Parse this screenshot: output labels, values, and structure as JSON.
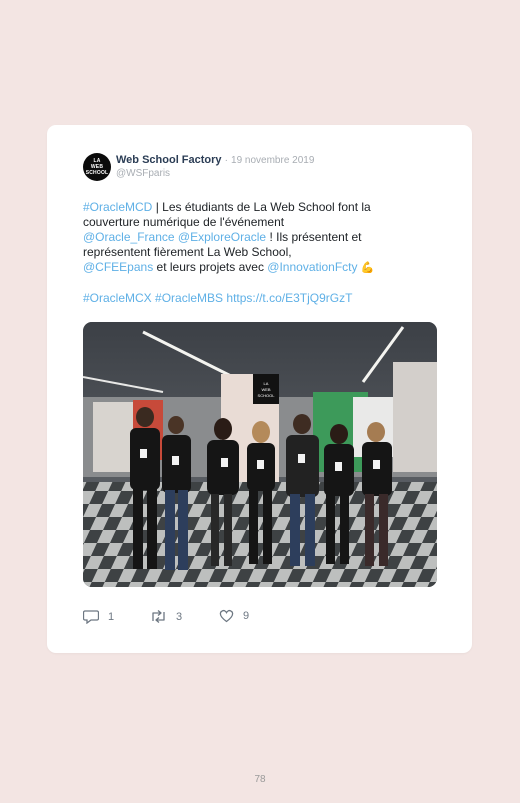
{
  "author": {
    "name": "Web School Factory",
    "separator": "·",
    "date": "19 novembre 2019",
    "handle": "@WSFparis",
    "avatar_lines": [
      "LA",
      "WEB",
      "SCHOOL"
    ]
  },
  "tweet": {
    "line1_tag": "#OracleMCD",
    "line1_text": " | Les étudiants de La Web School font la",
    "line2": "couverture numérique de l'événement",
    "line3_link1": "@Oracle_France",
    "line3_space": " ",
    "line3_link2": "@ExploreOracle",
    "line3_text": " ! Ils présentent et",
    "line4": "représentent fièrement La Web School,",
    "line5_link1": "@CFEEpans",
    "line5_text": " et leurs projets avec ",
    "line5_link2": "@InnovationFcty",
    "emoji": "💪",
    "line6_tag1": "#OracleMCX",
    "line6_space1": " ",
    "line6_tag2": "#OracleMBS",
    "line6_space2": " ",
    "line6_url": "https://t.co/E3TjQ9rGzT"
  },
  "photo": {
    "stand_sign": [
      "LA",
      "WEB",
      "SCHOOL"
    ]
  },
  "actions": {
    "replies": "1",
    "retweets": "3",
    "likes": "9"
  },
  "page": {
    "number": "78"
  },
  "colors": {
    "background": "#f3e5e3",
    "link": "#5fb0e6",
    "name": "#2b3d55"
  }
}
